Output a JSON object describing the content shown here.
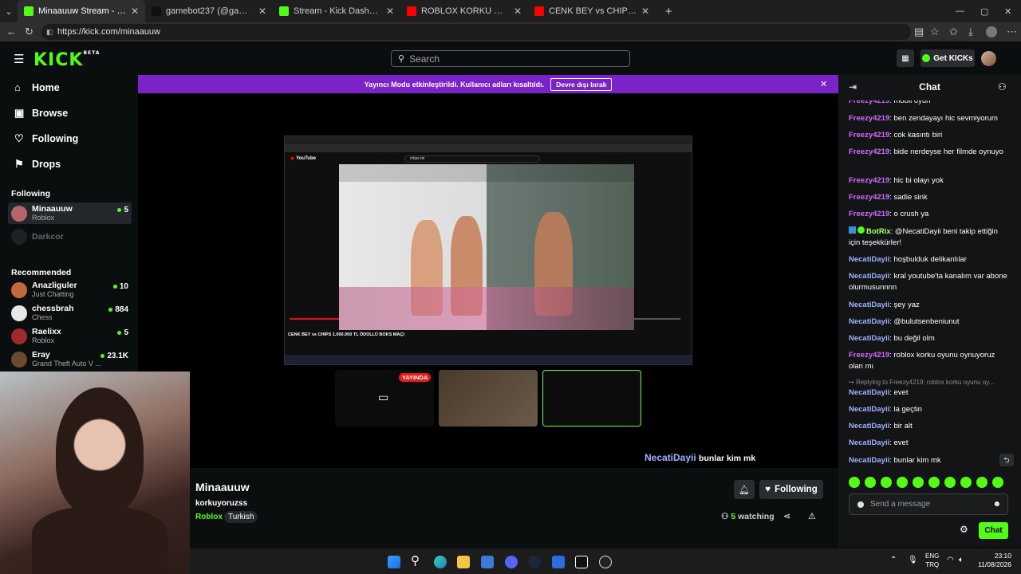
{
  "browser": {
    "tabs": [
      {
        "title": "Minaauuw Stream - Watch Live on Kick",
        "color": "#53fc18",
        "active": true
      },
      {
        "title": "gamebot237 (@gamebot237) | TikTok",
        "color": "#111111",
        "active": false
      },
      {
        "title": "Stream - Kick Dashboard",
        "color": "#53fc18",
        "active": false
      },
      {
        "title": "ROBLOX KORKU OYUNU KÜFÜRSÜZ",
        "color": "#ff0000",
        "active": false
      },
      {
        "title": "CENK BEY vs CHIPS 1.000.000 TL ÖDÜLLÜ BOKS MAÇI",
        "color": "#ff0000",
        "active": false
      }
    ],
    "url": "https://kick.com/minaauuw",
    "new_tab_icon": "plus-icon"
  },
  "header": {
    "logo": "KICK",
    "logo_badge": "BETA",
    "search_placeholder": "Search",
    "get_kicks": "Get KICKs"
  },
  "sidebar": {
    "nav": [
      {
        "label": "Home",
        "icon": "home-icon"
      },
      {
        "label": "Browse",
        "icon": "browse-icon"
      },
      {
        "label": "Following",
        "icon": "heart-icon"
      },
      {
        "label": "Drops",
        "icon": "drops-icon"
      }
    ],
    "following_heading": "Following",
    "following": [
      {
        "name": "Minaauuw",
        "category": "Roblox",
        "viewers": "5",
        "live": true
      },
      {
        "name": "Darkcor",
        "category": "",
        "viewers": "",
        "live": false
      }
    ],
    "recommended_heading": "Recommended",
    "recommended": [
      {
        "name": "Anazliguler",
        "category": "Just Chatting",
        "viewers": "10"
      },
      {
        "name": "chessbrah",
        "category": "Chess",
        "viewers": "884"
      },
      {
        "name": "Raelixx",
        "category": "Roblox",
        "viewers": "5"
      },
      {
        "name": "Eray",
        "category": "Grand Theft Auto V ...",
        "viewers": "23.1K"
      }
    ]
  },
  "banner": {
    "text": "Yayıncı Modu etkinleştirildi. Kullanıcı adları kısaltıldı.",
    "button": "Devre dışı bırak"
  },
  "player": {
    "live_badge": "YAYINDA",
    "overlay_user": "NecatiDayii",
    "overlay_text": "bunlar kim mk",
    "inner_video_title": "CENK BEY vs CHIPS 1.000.000 TL ÖDÜLLÜ BOKS MAÇI",
    "inner_search": "chips tel"
  },
  "stream": {
    "streamer": "Minaauuw",
    "title": "korkuyoruzss",
    "category": "Roblox",
    "language": "Turkish",
    "follow_label": "Following",
    "viewers": "5",
    "watching_label": "watching"
  },
  "chat": {
    "title": "Chat",
    "messages": [
      {
        "user": "Freezy4219",
        "text": "mobil oyun",
        "style": "u1"
      },
      {
        "user": "Freezy4219",
        "text": "ben zendayayı hic sevmiyorum",
        "style": "u1"
      },
      {
        "user": "Freezy4219",
        "text": "cok kasıntı biri",
        "style": "u1"
      },
      {
        "user": "Freezy4219",
        "text": "bide nerdeyse her filmde oynuyo",
        "style": "u1"
      },
      {
        "user": "Freezy4219",
        "text": "hic bi olayı yok",
        "style": "u1"
      },
      {
        "user": "Freezy4219",
        "text": "sadie sink",
        "style": "u1"
      },
      {
        "user": "Freezy4219",
        "text": "o crush ya",
        "style": "u1"
      },
      {
        "user": "BotRix",
        "text": "@NecatiDayii beni takip ettiğin için teşekkürler!",
        "style": "u3"
      },
      {
        "user": "NecatiDayii",
        "text": "hoşbulduk delikanlılar",
        "style": "u2"
      },
      {
        "user": "NecatiDayii",
        "text": "kral youtube'ta kanalım var abone olurmusunnnn",
        "style": "u2"
      },
      {
        "user": "NecatiDayii",
        "text": "şey yaz",
        "style": "u2"
      },
      {
        "user": "NecatiDayii",
        "text": "@bulutsenbeniunut",
        "style": "u2"
      },
      {
        "user": "NecatiDayii",
        "text": "bu değil olm",
        "style": "u2"
      },
      {
        "user": "Freezy4219",
        "text": "roblox korku oyunu oynuyoruz olan mı",
        "style": "u1"
      },
      {
        "user": "NecatiDayii",
        "text": "evet",
        "style": "u2"
      },
      {
        "user": "NecatiDayii",
        "text": "la geçtin",
        "style": "u2"
      },
      {
        "user": "NecatiDayii",
        "text": "bir alt",
        "style": "u2"
      },
      {
        "user": "NecatiDayii",
        "text": "evet",
        "style": "u2"
      },
      {
        "user": "NecatiDayii",
        "text": "bunlar kim mk",
        "style": "u2"
      }
    ],
    "reply_note": "Replying to Freezy4219: roblox korku oyunu oy...",
    "input_placeholder": "Send a message",
    "send_label": "Chat"
  },
  "taskbar": {
    "lang_top": "ENG",
    "lang_bottom": "TRQ",
    "time": "23:10",
    "date": "11/08/2026"
  }
}
